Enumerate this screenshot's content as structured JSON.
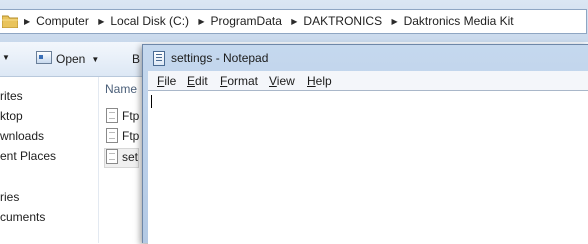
{
  "explorer": {
    "breadcrumbs": [
      "Computer",
      "Local Disk (C:)",
      "ProgramData",
      "DAKTRONICS",
      "Daktronics Media Kit"
    ],
    "toolbar": {
      "open_label": "Open",
      "partial_label": "B"
    },
    "nav_items": [
      "rites",
      "ktop",
      "wnloads",
      "ent Places",
      "ries",
      "cuments"
    ],
    "column_header": "Name",
    "files": [
      "Ftp",
      "Ftp",
      "set"
    ]
  },
  "notepad": {
    "title": "settings - Notepad",
    "menu": [
      {
        "accel": "F",
        "rest": "ile"
      },
      {
        "accel": "E",
        "rest": "dit"
      },
      {
        "accel": "F",
        "rest": "ormat"
      },
      {
        "accel": "V",
        "rest": "iew"
      },
      {
        "accel": "H",
        "rest": "elp"
      }
    ],
    "content": ""
  },
  "icons": {
    "folder": "folder-icon",
    "breadcrumb_separator": "chevron-right-icon",
    "open": "open-icon",
    "dropdown": "chevron-down-icon",
    "file": "file-icon",
    "notepad": "notepad-icon"
  },
  "colors": {
    "titlebar": "#c5d8ee",
    "address_band": "#dbe6f3"
  }
}
